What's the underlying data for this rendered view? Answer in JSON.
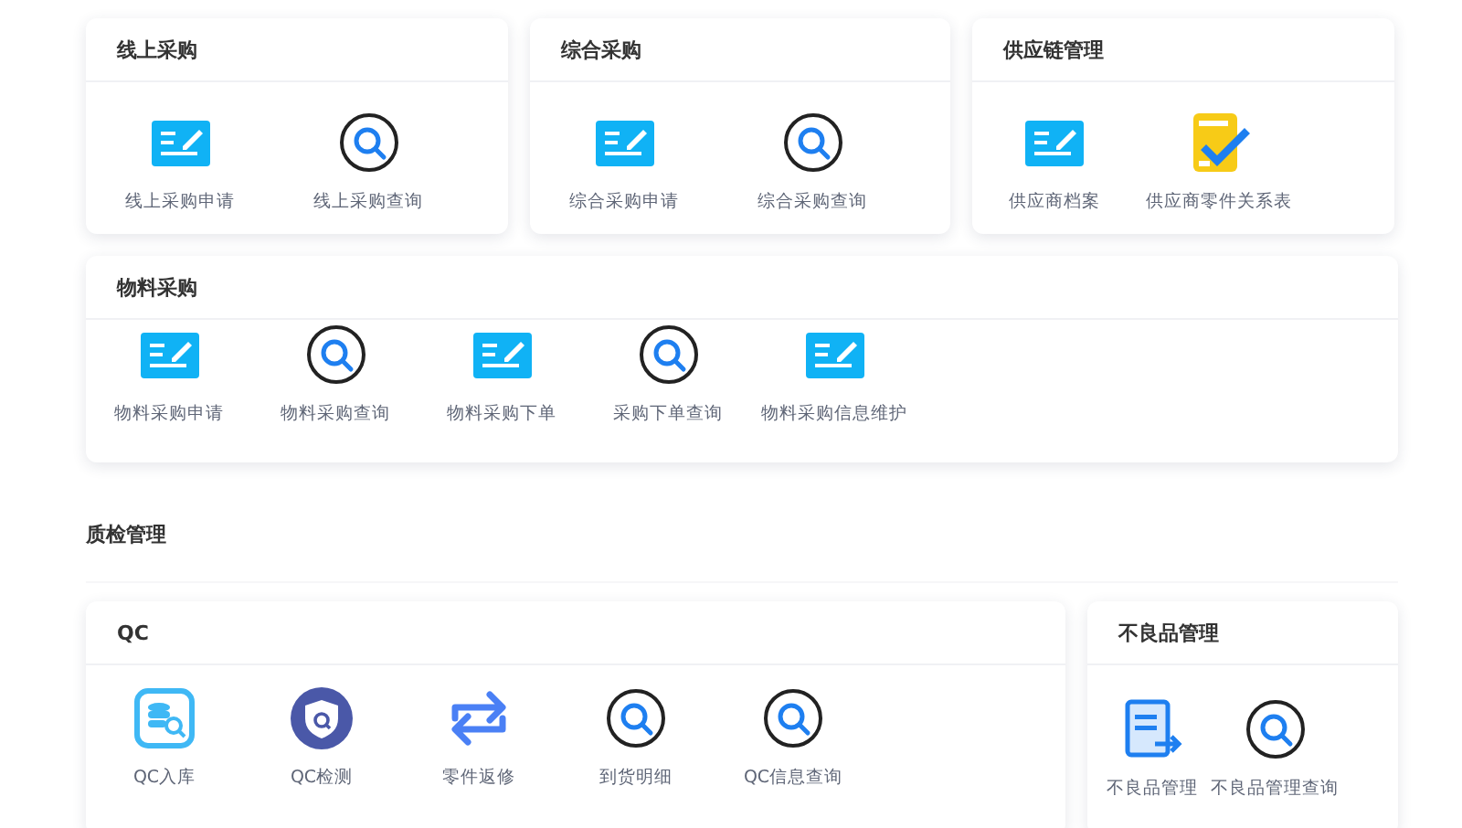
{
  "rows": [
    {
      "cards": [
        {
          "title": "线上采购",
          "items": [
            {
              "kind": "form",
              "label": "线上采购申请"
            },
            {
              "kind": "search",
              "label": "线上采购查询"
            }
          ]
        },
        {
          "title": "综合采购",
          "items": [
            {
              "kind": "form",
              "label": "综合采购申请"
            },
            {
              "kind": "search",
              "label": "综合采购查询"
            }
          ]
        },
        {
          "title": "供应链管理",
          "items": [
            {
              "kind": "form",
              "label": "供应商档案"
            },
            {
              "kind": "checklist",
              "label": "供应商零件关系表"
            }
          ]
        }
      ]
    },
    {
      "cards": [
        {
          "title": "物料采购",
          "items": [
            {
              "kind": "form",
              "label": "物料采购申请"
            },
            {
              "kind": "search",
              "label": "物料采购查询"
            },
            {
              "kind": "form",
              "label": "物料采购下单"
            },
            {
              "kind": "search",
              "label": "采购下单查询"
            },
            {
              "kind": "form",
              "label": "物料采购信息维护"
            }
          ]
        }
      ]
    }
  ],
  "section": {
    "title": "质检管理",
    "cards": [
      {
        "title": "QC",
        "items": [
          {
            "kind": "database",
            "label": "QC入库"
          },
          {
            "kind": "shield",
            "label": "QC检测"
          },
          {
            "kind": "swap",
            "label": "零件返修"
          },
          {
            "kind": "search",
            "label": "到货明细"
          },
          {
            "kind": "search",
            "label": "QC信息查询"
          }
        ]
      },
      {
        "title": "不良品管理",
        "items": [
          {
            "kind": "export",
            "label": "不良品管理"
          },
          {
            "kind": "search",
            "label": "不良品管理查询"
          }
        ]
      }
    ]
  }
}
